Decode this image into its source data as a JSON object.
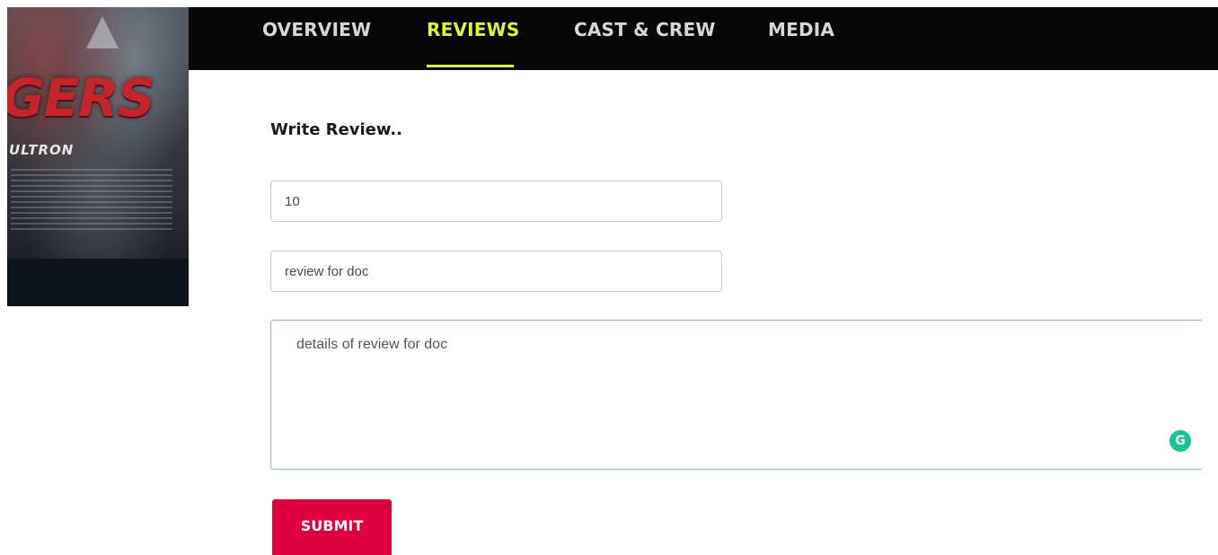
{
  "poster": {
    "title": "GERS",
    "subtitle": "ULTRON"
  },
  "nav": {
    "tabs": [
      {
        "label": "OVERVIEW",
        "active": false
      },
      {
        "label": "REVIEWS",
        "active": true
      },
      {
        "label": "CAST & CREW",
        "active": false
      },
      {
        "label": "MEDIA",
        "active": false
      }
    ]
  },
  "form": {
    "heading": "Write Review..",
    "score_value": "10",
    "title_value": "review for doc",
    "details_value": "details of review for doc",
    "submit_label": "SUBMIT"
  },
  "colors": {
    "nav_background": "#070707",
    "nav_active": "#dcf836",
    "nav_inactive": "#d7d7d7",
    "submit_background": "#dd003f",
    "textarea_focus_border": "#80b6e4",
    "grammarly": "#15c39a"
  },
  "icons": {
    "grammarly": "grammarly-icon"
  }
}
